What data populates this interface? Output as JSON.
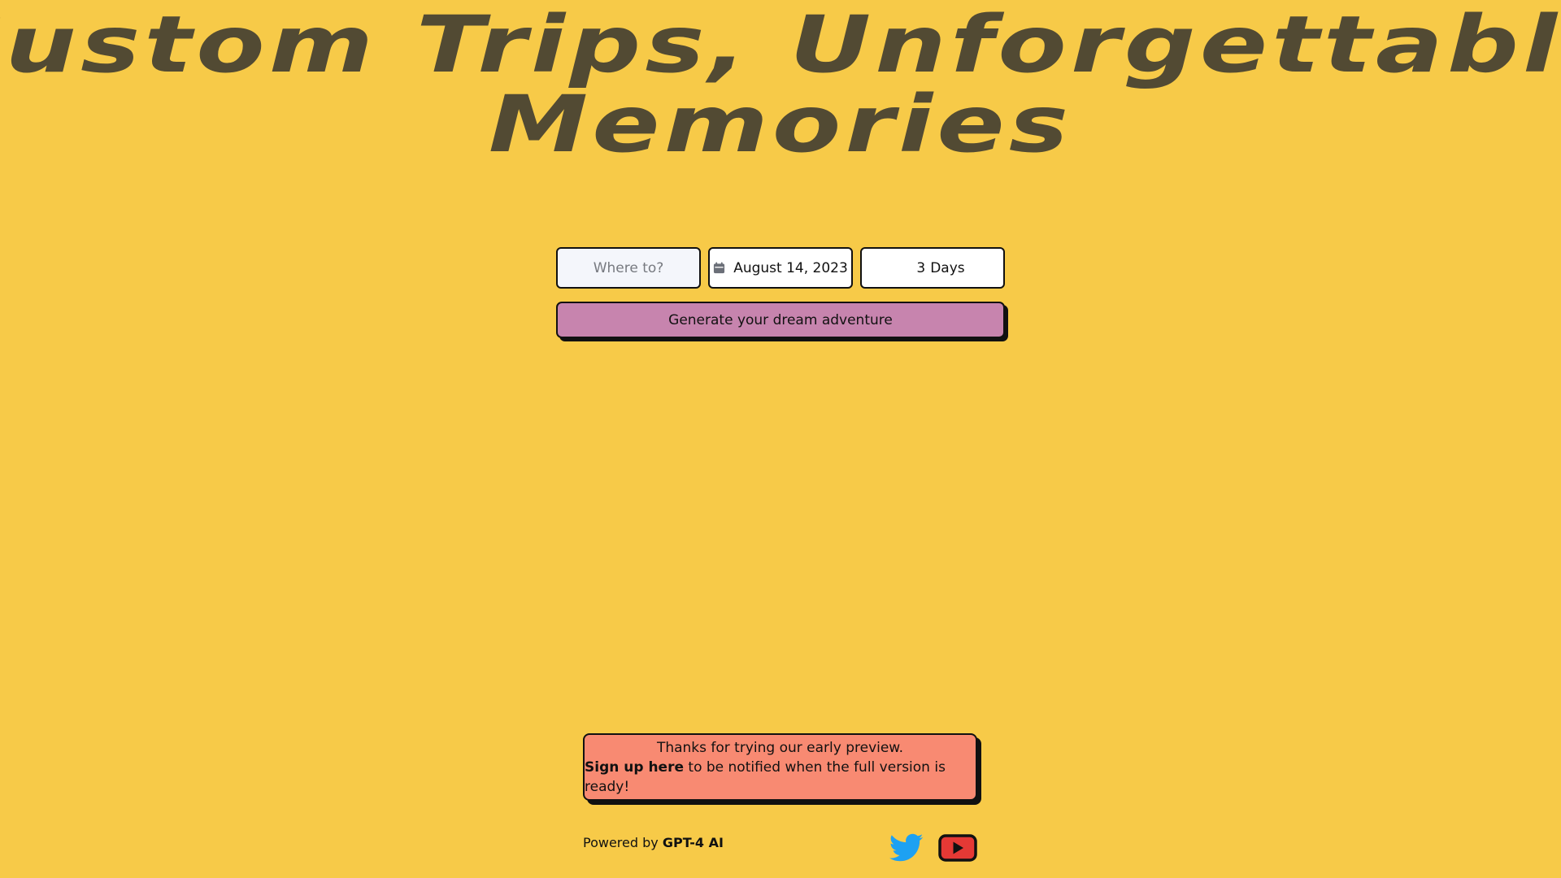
{
  "hero": {
    "title_line1": "Custom Trips, Unforgettable",
    "title_line2": "Memories"
  },
  "form": {
    "destination_placeholder": "Where to?",
    "destination_value": "",
    "date_value": "August 14, 2023",
    "days_value": "3",
    "days_unit": "Days",
    "generate_label": "Generate your dream adventure"
  },
  "banner": {
    "line1": "Thanks for trying our early preview.",
    "signup_label": "Sign up here",
    "line2_rest": " to be notified when the full version is ready!"
  },
  "footer": {
    "powered_prefix": "Powered by ",
    "powered_brand": "GPT-4 AI"
  },
  "social": {
    "twitter_icon": "twitter-icon",
    "youtube_icon": "youtube-icon"
  },
  "colors": {
    "background": "#F7CA48",
    "title": "#524A33",
    "button": "#C784AE",
    "banner": "#F88A72",
    "twitter": "#1DA1F2",
    "youtube": "#E53935"
  }
}
